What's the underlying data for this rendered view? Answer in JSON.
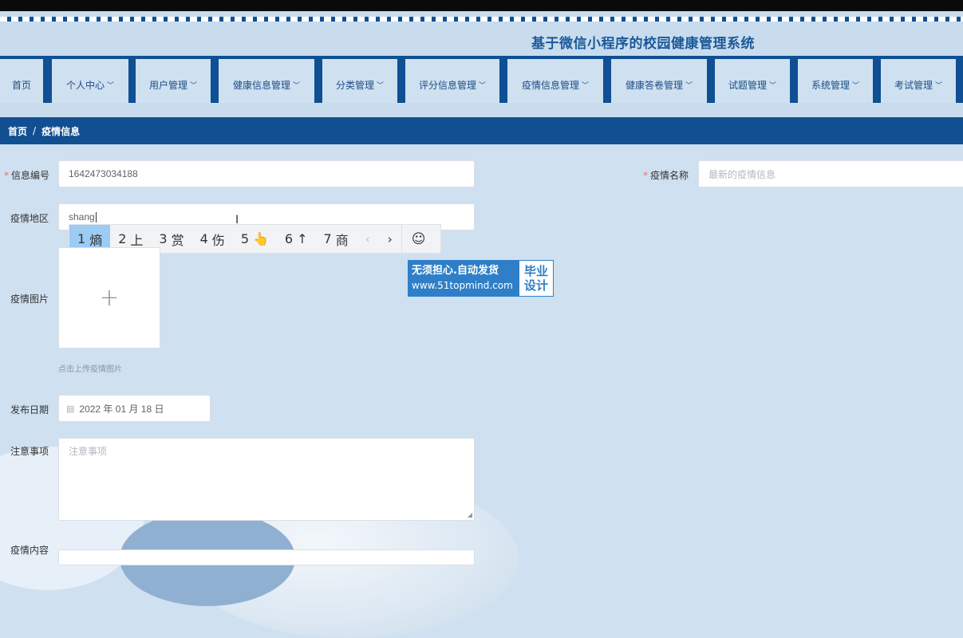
{
  "site": {
    "title": "基于微信小程序的校园健康管理系统"
  },
  "nav": {
    "items": [
      {
        "label": "首页",
        "has_dropdown": false
      },
      {
        "label": "个人中心",
        "has_dropdown": true
      },
      {
        "label": "用户管理",
        "has_dropdown": true
      },
      {
        "label": "健康信息管理",
        "has_dropdown": true
      },
      {
        "label": "分类管理",
        "has_dropdown": true
      },
      {
        "label": "评分信息管理",
        "has_dropdown": true
      },
      {
        "label": "疫情信息管理",
        "has_dropdown": true
      },
      {
        "label": "健康答卷管理",
        "has_dropdown": true
      },
      {
        "label": "试题管理",
        "has_dropdown": true
      },
      {
        "label": "系统管理",
        "has_dropdown": true
      },
      {
        "label": "考试管理",
        "has_dropdown": true
      }
    ]
  },
  "breadcrumb": {
    "home": "首页",
    "separator": "/",
    "current": "疫情信息"
  },
  "form": {
    "info_no": {
      "label": "信息编号",
      "value": "1642473034188"
    },
    "epidemic_name": {
      "label": "疫情名称",
      "placeholder": "最新的疫情信息"
    },
    "region": {
      "label": "疫情地区",
      "value": "shang"
    },
    "image": {
      "label": "疫情图片",
      "hint": "点击上传疫情图片",
      "plus": "+"
    },
    "publish_date": {
      "label": "发布日期",
      "value": "2022 年 01 月 18 日"
    },
    "notes": {
      "label": "注意事项",
      "placeholder": "注意事项"
    },
    "content": {
      "label": "疫情内容"
    }
  },
  "ime": {
    "candidates": [
      {
        "num": "1",
        "text": "熵"
      },
      {
        "num": "2",
        "text": "上"
      },
      {
        "num": "3",
        "text": "赏"
      },
      {
        "num": "4",
        "text": "伤"
      },
      {
        "num": "5",
        "text": "👆"
      },
      {
        "num": "6",
        "text": "↑"
      },
      {
        "num": "7",
        "text": "商"
      }
    ],
    "prev": "‹",
    "next": "›",
    "emoji": "☺"
  },
  "watermark": {
    "line1": "无须担心.自动发货",
    "line2": "www.51topmind.com",
    "tag1": "毕业",
    "tag2": "设计"
  },
  "colors": {
    "nav_bg": "#0f4f93",
    "breadcrumb_bg": "#124f90",
    "required": "#f56c6c",
    "ime_active": "#9ccbf4"
  }
}
